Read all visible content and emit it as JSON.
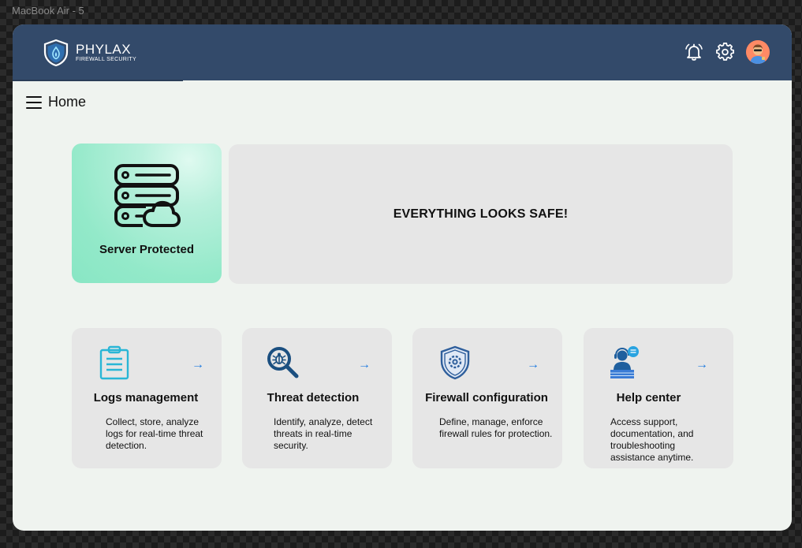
{
  "frame_label": "MacBook Air - 5",
  "brand": {
    "name": "PHYLAX",
    "tagline": "FIREWALL SECURITY"
  },
  "header_icons": [
    "bell-icon",
    "gear-icon",
    "avatar"
  ],
  "nav": {
    "menu_icon": "hamburger-icon",
    "page_title": "Home"
  },
  "server_status": {
    "label": "Server Protected",
    "icon": "server-cloud-icon",
    "color": "#93e9c9"
  },
  "status_banner": {
    "message": "EVERYTHING LOOKS SAFE!"
  },
  "features": [
    {
      "title": "Logs management",
      "description": "Collect, store, analyze logs for real-time threat detection.",
      "icon": "clipboard-icon",
      "arrow": "→"
    },
    {
      "title": "Threat detection",
      "description": "Identify, analyze, detect threats in real-time security.",
      "icon": "bug-search-icon",
      "arrow": "→"
    },
    {
      "title": "Firewall configuration",
      "description": "Define, manage, enforce firewall rules for protection.",
      "icon": "shield-gear-icon",
      "arrow": "→"
    },
    {
      "title": "Help center",
      "description": "Access support, documentation, and troubleshooting assistance anytime.",
      "icon": "support-agent-icon",
      "arrow": "→"
    }
  ],
  "colors": {
    "header": "#334a6a",
    "accent": "#1e7ae0",
    "card": "#e6e6e6",
    "background": "#eff3ef"
  }
}
